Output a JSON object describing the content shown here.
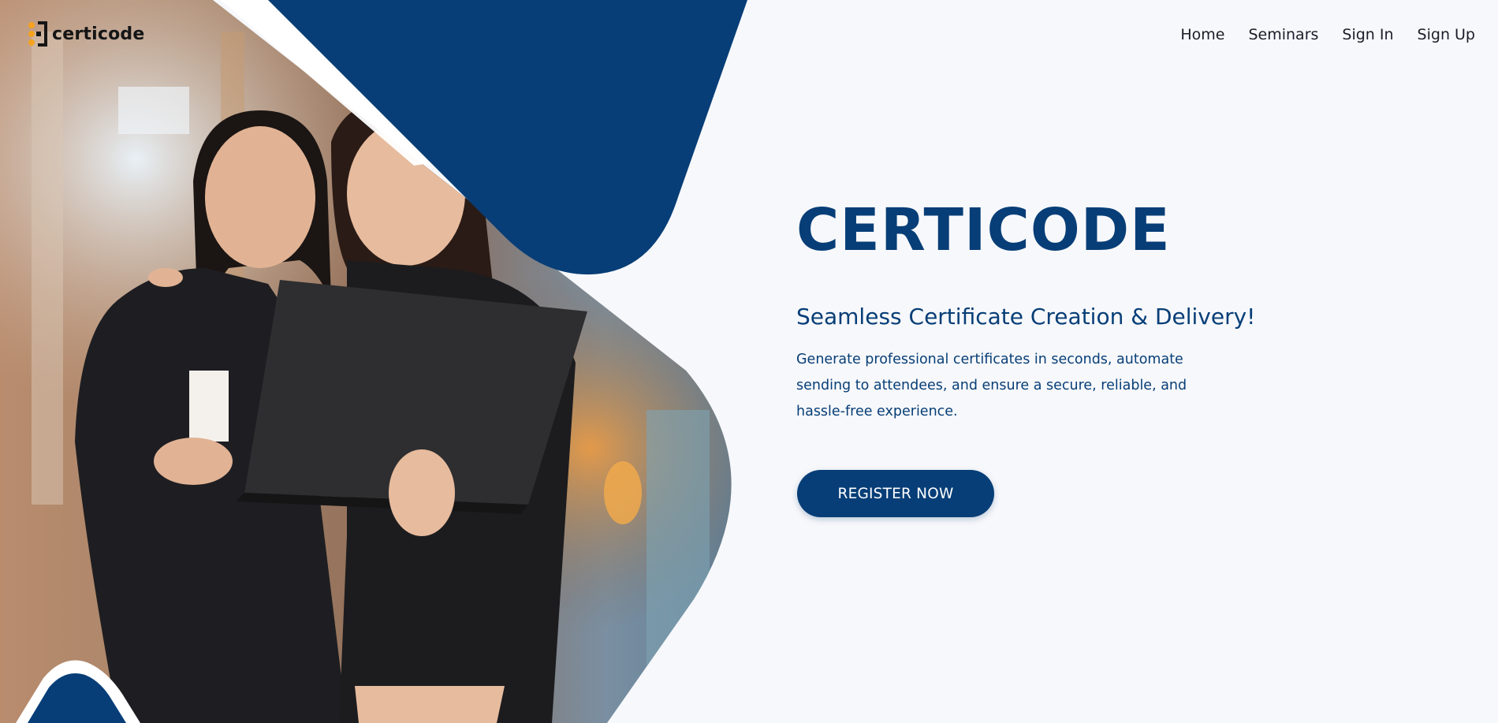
{
  "brand": {
    "name": "certicode",
    "logo_icon": "certicode-logo-icon",
    "color_primary": "#073e77",
    "color_accent": "#f5a21e"
  },
  "nav": {
    "items": [
      {
        "label": "Home"
      },
      {
        "label": "Seminars"
      },
      {
        "label": "Sign In"
      },
      {
        "label": "Sign Up"
      }
    ]
  },
  "hero": {
    "title": "CERTICODE",
    "subtitle": "Seamless Certificate Creation & Delivery!",
    "description": "Generate professional certificates in seconds, automate sending to attendees, and ensure a secure, reliable, and hassle-free experience.",
    "cta_label": "REGISTER NOW",
    "image": "two-women-with-laptop-photo"
  }
}
